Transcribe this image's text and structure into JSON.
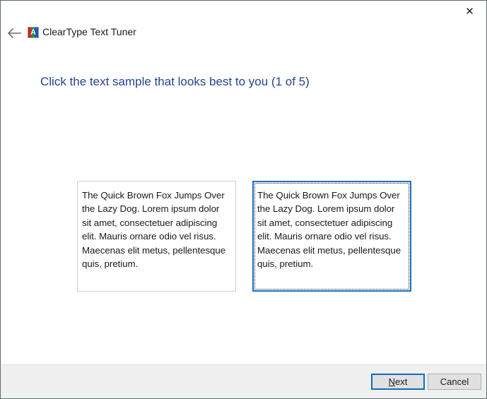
{
  "window": {
    "title": "ClearType Text Tuner",
    "icon_name": "cleartype-app-icon",
    "icon_letter": "A",
    "close_glyph": "✕",
    "back_glyph": "←"
  },
  "page": {
    "heading": "Click the text sample that looks best to you (1 of 5)",
    "heading_color": "#25428f",
    "step_current": 1,
    "step_total": 5
  },
  "samples": [
    {
      "id": "sample-1",
      "selected": false,
      "text": "The Quick Brown Fox Jumps Over the Lazy Dog. Lorem ipsum dolor sit amet, consectetuer adipiscing elit. Mauris ornare odio vel risus. Maecenas elit metus, pellentesque quis, pretium."
    },
    {
      "id": "sample-2",
      "selected": true,
      "text": "The Quick Brown Fox Jumps Over the Lazy Dog. Lorem ipsum dolor sit amet, consectetuer adipiscing elit. Mauris ornare odio vel risus. Maecenas elit metus, pellentesque quis, pretium."
    }
  ],
  "footer": {
    "next_label": "Next",
    "next_accel": "N",
    "next_rest": "ext",
    "cancel_label": "Cancel"
  },
  "colors": {
    "accent_blue": "#1771c4",
    "default_button_border": "#0f6cbd",
    "heading_blue": "#25428f",
    "footer_bg": "#f0f0f0",
    "window_border": "#5b6b6b"
  }
}
